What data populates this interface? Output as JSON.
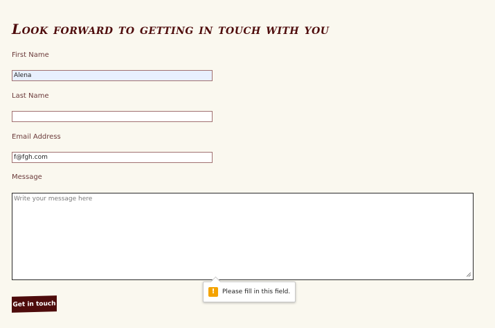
{
  "form": {
    "title": "Look forward to getting in touch with you",
    "first_name": {
      "label": "First Name",
      "value": "Alena"
    },
    "last_name": {
      "label": "Last Name",
      "value": ""
    },
    "email": {
      "label": "Email Address",
      "value": "f@fgh.com"
    },
    "message": {
      "label": "Message",
      "placeholder": "Write your message here",
      "value": ""
    },
    "submit_label": "Get in touch"
  },
  "validation_tooltip": {
    "icon": "warning-icon",
    "icon_glyph": "!",
    "text": "Please fill in this field."
  },
  "colors": {
    "background": "#faf8ef",
    "accent": "#4e0c0c",
    "label": "#6b3a3a",
    "warning": "#f4a300"
  }
}
